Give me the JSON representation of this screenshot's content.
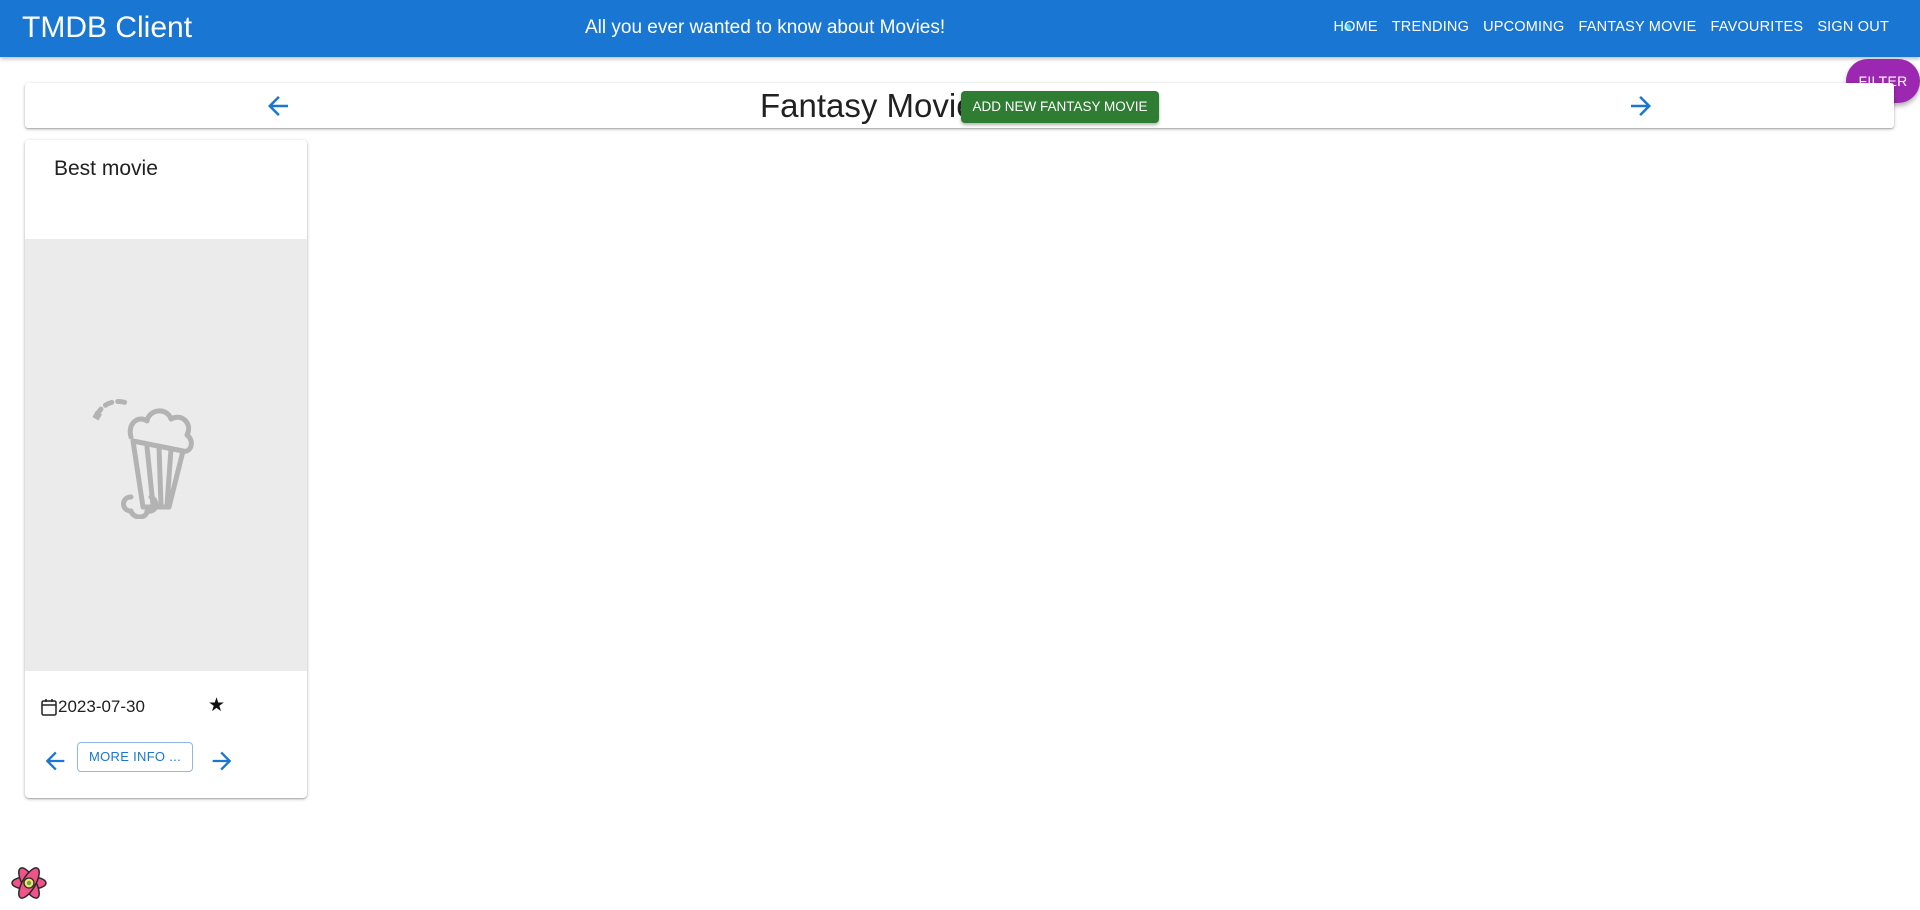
{
  "app": {
    "title": "TMDB Client",
    "tagline": "All you ever wanted to know about Movies!",
    "nav": [
      "HOME",
      "TRENDING",
      "UPCOMING",
      "FANTASY MOVIE",
      "FAVOURITES",
      "SIGN OUT"
    ]
  },
  "filter_button": "FILTER",
  "header": {
    "title": "Fantasy Movie",
    "add_button": "ADD NEW FANTASY MOVIE"
  },
  "movie_card": {
    "title": "Best movie",
    "release_date": "2023-07-30",
    "rating_icon": "★",
    "more_info_button": "MORE INFO ..."
  },
  "colors": {
    "appbar": "#1976d2",
    "filter_button": "#9c27b0",
    "add_button": "#2e7d32",
    "poster_placeholder": "#ebebeb"
  },
  "icons": [
    "arrow-back-icon",
    "arrow-forward-icon",
    "calendar-icon",
    "star-icon",
    "popcorn-placeholder-icon",
    "react-devtools-icon"
  ]
}
